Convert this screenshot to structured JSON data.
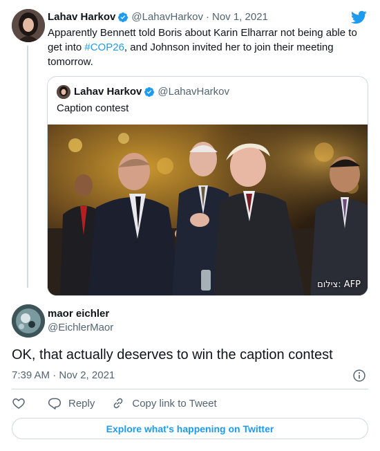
{
  "colors": {
    "accent": "#1d9bf0",
    "text": "#0f1419",
    "muted": "#536471",
    "border": "#cfd9de"
  },
  "logo_icon": "twitter-bird-icon",
  "parent_tweet": {
    "author_name": "Lahav Harkov",
    "author_handle": "@LahavHarkov",
    "separator": "·",
    "date": "Nov 1, 2021",
    "text_before": "Apparently Bennett told Boris about Karin Elharrar not being able to get into ",
    "hashtag": "#COP26",
    "text_after": ", and Johnson invited her to join their meeting tomorrow.",
    "verified_icon": "verified-badge-icon"
  },
  "quoted_tweet": {
    "author_name": "Lahav Harkov",
    "author_handle": "@LahavHarkov",
    "text": "Caption contest",
    "photo_credit": "צילום: AFP"
  },
  "reply_tweet": {
    "author_name": "maor eichler",
    "author_handle": "@EichlerMaor",
    "text": "OK, that actually deserves to win the caption contest",
    "timestamp": "7:39 AM · Nov 2, 2021",
    "info_icon": "info-icon"
  },
  "actions": {
    "like_icon": "heart-icon",
    "reply_icon": "reply-icon",
    "reply_label": "Reply",
    "copy_icon": "link-icon",
    "copy_label": "Copy link to Tweet"
  },
  "explore_button": {
    "label": "Explore what's happening on Twitter"
  }
}
